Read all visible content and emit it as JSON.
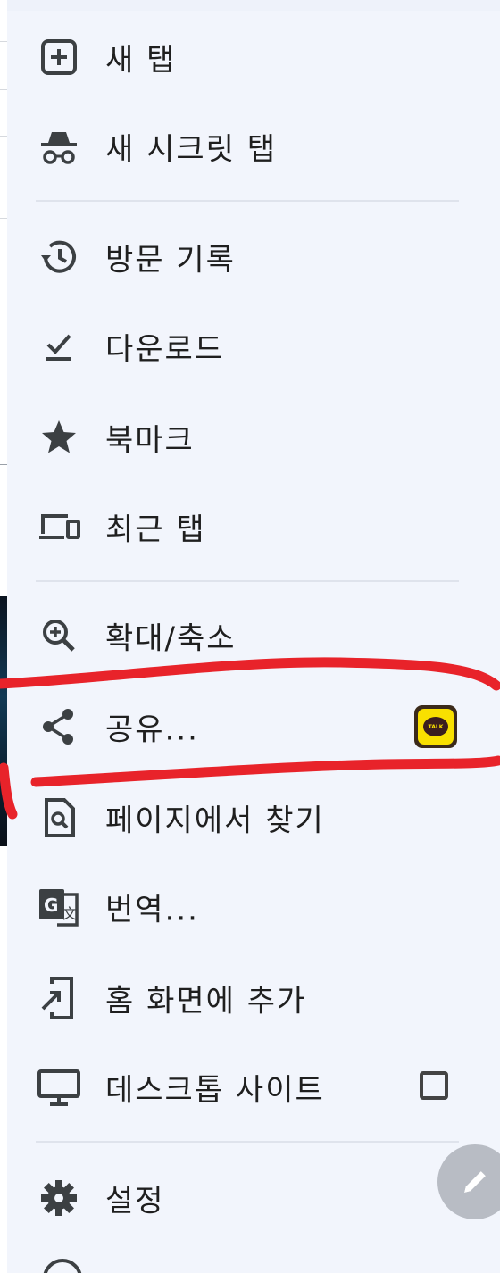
{
  "menu": {
    "items": [
      {
        "label": "새 탭",
        "icon": "new-tab-icon"
      },
      {
        "label": "새 시크릿 탭",
        "icon": "incognito-icon"
      },
      {
        "label": "방문 기록",
        "icon": "history-icon"
      },
      {
        "label": "다운로드",
        "icon": "download-icon"
      },
      {
        "label": "북마크",
        "icon": "star-icon"
      },
      {
        "label": "최근 탭",
        "icon": "devices-icon"
      },
      {
        "label": "확대/축소",
        "icon": "zoom-icon"
      },
      {
        "label": "공유...",
        "icon": "share-icon",
        "trailing": "kakaotalk-icon",
        "trailing_text": "TALK"
      },
      {
        "label": "페이지에서 찾기",
        "icon": "find-in-page-icon"
      },
      {
        "label": "번역...",
        "icon": "translate-icon"
      },
      {
        "label": "홈 화면에 추가",
        "icon": "add-to-home-icon"
      },
      {
        "label": "데스크톱 사이트",
        "icon": "desktop-icon",
        "checked": false
      },
      {
        "label": "설정",
        "icon": "gear-icon"
      }
    ]
  },
  "colors": {
    "menu_background": "#f2f5fc",
    "icon": "#3c4043",
    "text": "#1f1f1f",
    "divider": "#dfe3ec",
    "annotation": "#e8232a",
    "fab": "#b8bcc4"
  }
}
